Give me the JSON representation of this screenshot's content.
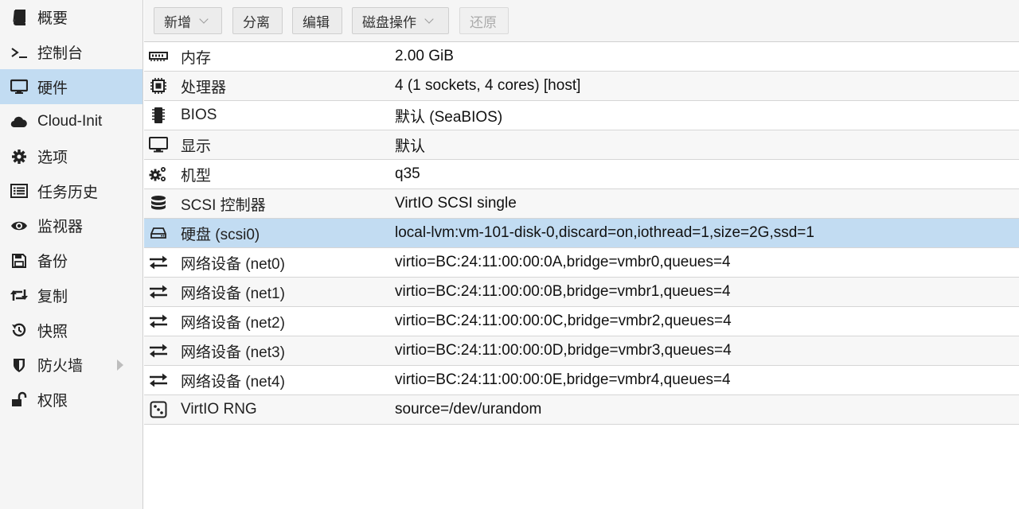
{
  "sidebar": {
    "items": [
      {
        "label": "概要",
        "icon": "book-icon",
        "selected": false
      },
      {
        "label": "控制台",
        "icon": "terminal-icon",
        "selected": false
      },
      {
        "label": "硬件",
        "icon": "desktop-icon",
        "selected": true
      },
      {
        "label": "Cloud-Init",
        "icon": "cloud-icon",
        "selected": false
      },
      {
        "label": "选项",
        "icon": "gear-icon",
        "selected": false
      },
      {
        "label": "任务历史",
        "icon": "list-icon",
        "selected": false
      },
      {
        "label": "监视器",
        "icon": "eye-icon",
        "selected": false
      },
      {
        "label": "备份",
        "icon": "floppy-icon",
        "selected": false
      },
      {
        "label": "复制",
        "icon": "retweet-icon",
        "selected": false
      },
      {
        "label": "快照",
        "icon": "history-icon",
        "selected": false
      },
      {
        "label": "防火墙",
        "icon": "shield-icon",
        "selected": false,
        "expandable": true
      },
      {
        "label": "权限",
        "icon": "unlock-icon",
        "selected": false
      }
    ]
  },
  "toolbar": {
    "add_label": "新增",
    "detach_label": "分离",
    "edit_label": "编辑",
    "disk_action_label": "磁盘操作",
    "revert_label": "还原"
  },
  "hardware": {
    "rows": [
      {
        "name": "内存",
        "value": "2.00 GiB",
        "icon": "memory-icon"
      },
      {
        "name": "处理器",
        "value": "4 (1 sockets, 4 cores) [host]",
        "icon": "cpu-icon"
      },
      {
        "name": "BIOS",
        "value": "默认 (SeaBIOS)",
        "icon": "microchip-icon"
      },
      {
        "name": "显示",
        "value": "默认",
        "icon": "monitor-icon"
      },
      {
        "name": "机型",
        "value": "q35",
        "icon": "cogs-icon"
      },
      {
        "name": "SCSI 控制器",
        "value": "VirtIO SCSI single",
        "icon": "database-icon"
      },
      {
        "name": "硬盘 (scsi0)",
        "value": "local-lvm:vm-101-disk-0,discard=on,iothread=1,size=2G,ssd=1",
        "icon": "hdd-icon",
        "selected": true
      },
      {
        "name": "网络设备 (net0)",
        "value": "virtio=BC:24:11:00:00:0A,bridge=vmbr0,queues=4",
        "icon": "exchange-icon"
      },
      {
        "name": "网络设备 (net1)",
        "value": "virtio=BC:24:11:00:00:0B,bridge=vmbr1,queues=4",
        "icon": "exchange-icon"
      },
      {
        "name": "网络设备 (net2)",
        "value": "virtio=BC:24:11:00:00:0C,bridge=vmbr2,queues=4",
        "icon": "exchange-icon"
      },
      {
        "name": "网络设备 (net3)",
        "value": "virtio=BC:24:11:00:00:0D,bridge=vmbr3,queues=4",
        "icon": "exchange-icon"
      },
      {
        "name": "网络设备 (net4)",
        "value": "virtio=BC:24:11:00:00:0E,bridge=vmbr4,queues=4",
        "icon": "exchange-icon"
      },
      {
        "name": "VirtIO RNG",
        "value": "source=/dev/urandom",
        "icon": "dice-icon"
      }
    ]
  },
  "colors": {
    "selected_bg": "#c2dcf2",
    "sidebar_bg": "#f5f5f5",
    "row_alt_bg": "#f7f7f7"
  }
}
